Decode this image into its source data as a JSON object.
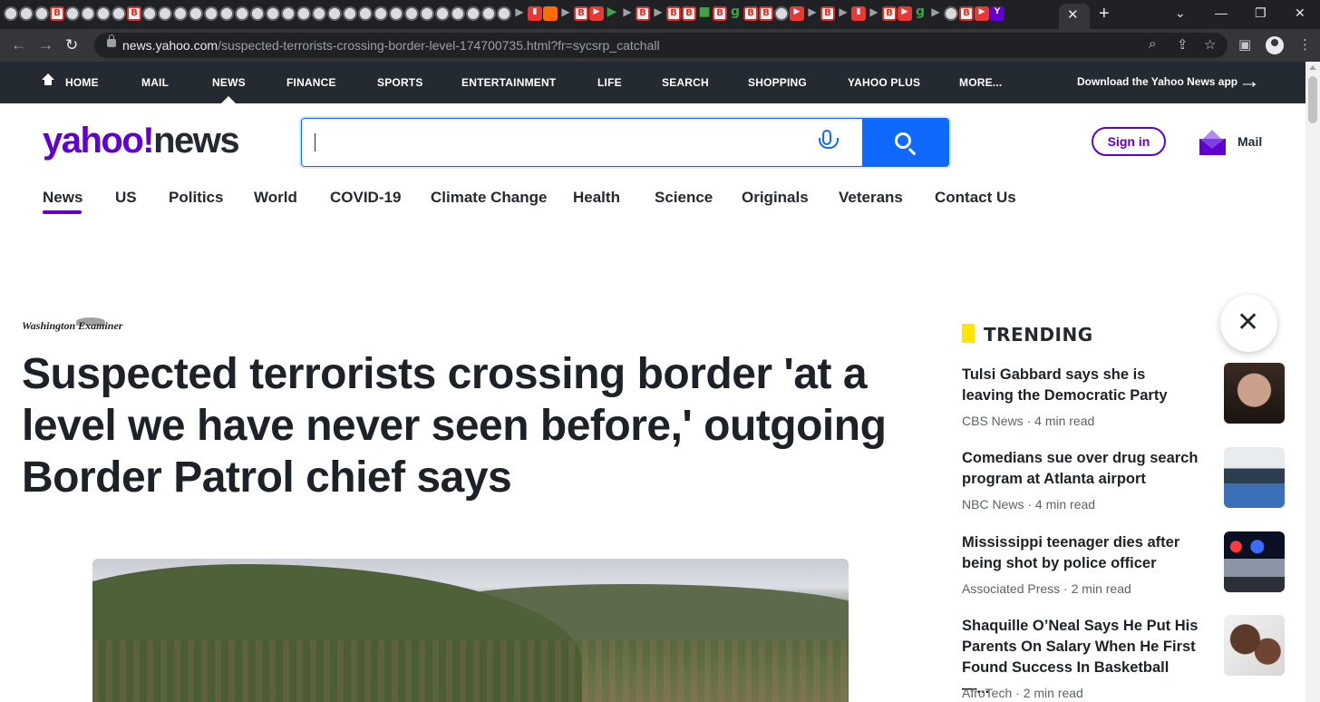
{
  "browser": {
    "tab_close": "✕",
    "new_tab": "+",
    "url_host": "news.yahoo.com",
    "url_path": "/suspected-terrorists-crossing-border-level-174700735.html?fr=sycsrp_catchall"
  },
  "topnav": {
    "items": [
      "HOME",
      "MAIL",
      "NEWS",
      "FINANCE",
      "SPORTS",
      "ENTERTAINMENT",
      "LIFE",
      "SEARCH",
      "SHOPPING",
      "YAHOO PLUS",
      "MORE..."
    ],
    "download_app": "Download the Yahoo News app"
  },
  "header": {
    "logo_yahoo": "yahoo!",
    "logo_news": "news",
    "search_value": "",
    "signin": "Sign in",
    "mail": "Mail"
  },
  "subnav": {
    "items": [
      "News",
      "US",
      "Politics",
      "World",
      "COVID-19",
      "Climate Change",
      "Health",
      "Science",
      "Originals",
      "Veterans",
      "Contact Us"
    ],
    "active": "News"
  },
  "article": {
    "publisher": "Washington Examiner",
    "headline": "Suspected terrorists crossing border 'at a level we have never seen before,' outgoing Border Patrol chief says"
  },
  "trending": {
    "title": "TRENDING",
    "items": [
      {
        "title": "Tulsi Gabbard says she is leaving the Democratic Party",
        "source": "CBS News",
        "read": "4 min read"
      },
      {
        "title": "Comedians sue over drug search program at Atlanta airport",
        "source": "NBC News",
        "read": "4 min read"
      },
      {
        "title": "Mississippi teenager dies after being shot by police officer",
        "source": "Associated Press",
        "read": "2 min read"
      },
      {
        "title": "Shaquille O’Neal Says He Put His Parents On Salary When He First Found Success In Basketball —...",
        "source": "AfroTech",
        "read": "2 min read"
      }
    ]
  },
  "colors": {
    "brand_purple": "#6001d2",
    "search_blue": "#0f69ff",
    "nav_dark": "#232a31",
    "trending_yellow": "#ffe500"
  }
}
